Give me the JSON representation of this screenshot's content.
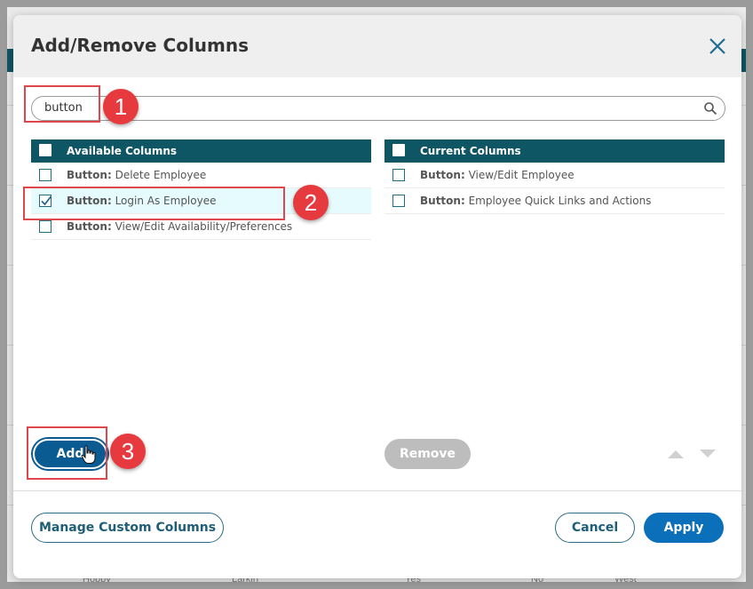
{
  "background": {
    "texts": [
      "Hobby",
      "Larkin",
      "Yes",
      "No",
      "West"
    ]
  },
  "dialog": {
    "title": "Add/Remove Columns",
    "search": {
      "value": "button",
      "placeholder": ""
    },
    "available": {
      "header": "Available Columns",
      "rows": [
        {
          "prefix": "Button:",
          "label": "Delete Employee",
          "checked": false
        },
        {
          "prefix": "Button:",
          "label": "Login As Employee",
          "checked": true
        },
        {
          "prefix": "Button:",
          "label": "View/Edit Availability/Preferences",
          "checked": false
        }
      ]
    },
    "current": {
      "header": "Current Columns",
      "rows": [
        {
          "prefix": "Button:",
          "label": "View/Edit Employee",
          "checked": false
        },
        {
          "prefix": "Button:",
          "label": "Employee Quick Links and Actions",
          "checked": false
        }
      ]
    },
    "buttons": {
      "add": "Add",
      "remove": "Remove",
      "manage": "Manage Custom Columns",
      "cancel": "Cancel",
      "apply": "Apply"
    }
  },
  "callouts": [
    "1",
    "2",
    "3"
  ],
  "colors": {
    "header_teal": "#0e5663",
    "primary_blue": "#0b6fba",
    "callout_red": "#e73a3f"
  }
}
